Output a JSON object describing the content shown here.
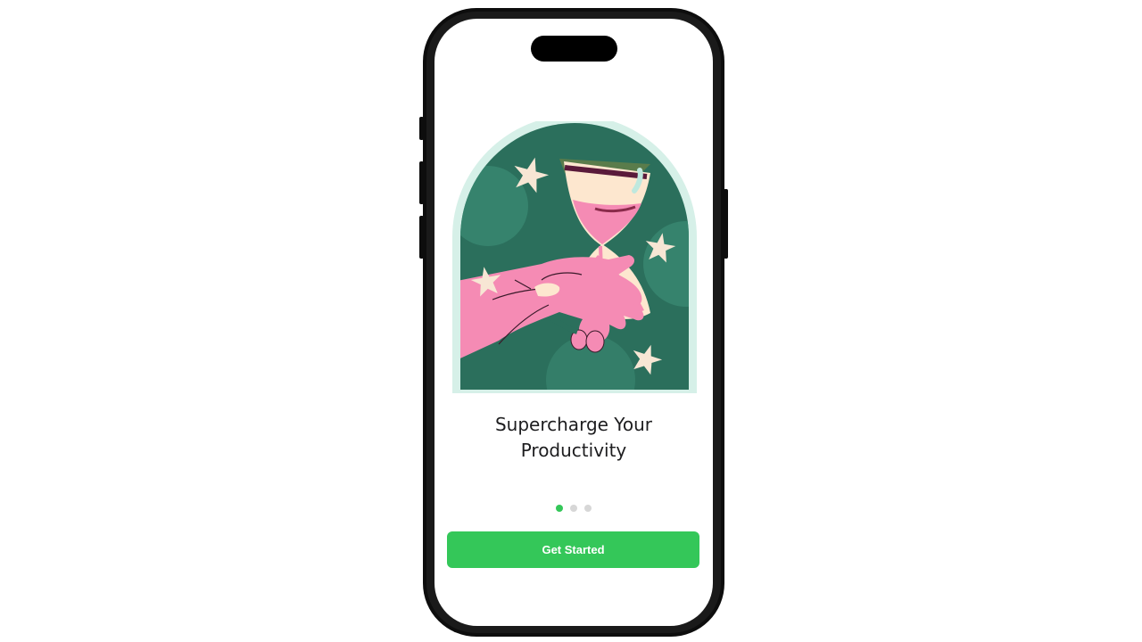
{
  "onboarding": {
    "headline_line1": "Supercharge Your",
    "headline_line2": "Productivity",
    "cta_label": "Get Started",
    "illustration_icon": "hourglass-in-hand-illustration",
    "pager": {
      "total": 3,
      "active_index": 0
    }
  },
  "colors": {
    "accent": "#34c759",
    "illustration_bg": "#2b6f5c",
    "illustration_rim": "#d6f0e8",
    "hand": "#f58bb4",
    "sand": "#fde7cf",
    "star": "#f7e6d4",
    "frame": "#0d0d0d"
  }
}
